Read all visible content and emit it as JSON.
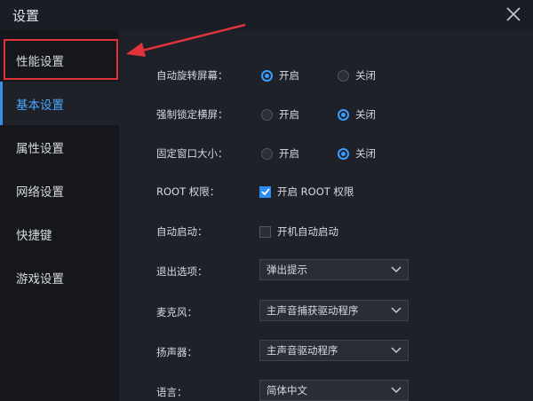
{
  "window": {
    "title": "设置"
  },
  "sidebar": {
    "items": [
      {
        "label": "性能设置"
      },
      {
        "label": "基本设置"
      },
      {
        "label": "属性设置"
      },
      {
        "label": "网络设置"
      },
      {
        "label": "快捷键"
      },
      {
        "label": "游戏设置"
      }
    ],
    "active": "基本设置"
  },
  "settings": {
    "auto_rotate": {
      "label": "自动旋转屏幕：",
      "on": "开启",
      "off": "关闭",
      "selected": "开启"
    },
    "force_landscape": {
      "label": "强制锁定横屏：",
      "on": "开启",
      "off": "关闭",
      "selected": "关闭"
    },
    "fixed_window": {
      "label": "固定窗口大小：",
      "on": "开启",
      "off": "关闭",
      "selected": "关闭"
    },
    "root": {
      "label": "ROOT 权限：",
      "checkbox": "开启 ROOT 权限",
      "checked": true
    },
    "autostart": {
      "label": "自动启动：",
      "checkbox": "开机自动启动",
      "checked": false
    },
    "exit_option": {
      "label": "退出选项：",
      "value": "弹出提示"
    },
    "microphone": {
      "label": "麦克风：",
      "value": "主声音捕获驱动程序"
    },
    "speaker": {
      "label": "扬声器：",
      "value": "主声音驱动程序"
    },
    "language": {
      "label": "语言：",
      "value": "简体中文"
    }
  },
  "colors": {
    "accent": "#3b9cff",
    "highlight": "#e0333a",
    "background": "#1f2129",
    "sidebar": "#16171c"
  },
  "icons": {
    "close": "close-icon",
    "dropdown": "chevron-down-icon",
    "check": "checkmark-icon",
    "annotation": "arrow-icon"
  }
}
